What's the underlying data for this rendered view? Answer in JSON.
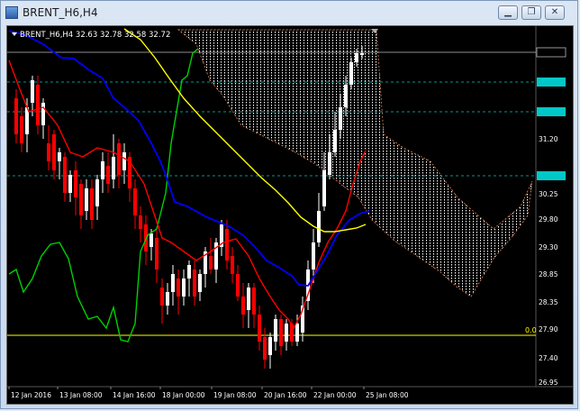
{
  "window": {
    "title": "BRENT_H6,H4",
    "minimize_icon": "minimize-icon",
    "restore_icon": "restore-icon",
    "close_icon": "close-icon"
  },
  "chart": {
    "header": "BRENT_H6,H4  32.63 32.78 32.58 32.72",
    "dropdown_icon": "triangle-down-icon",
    "price_labels": [
      "32.72",
      "32.16",
      "31.65",
      "31.20",
      "30.53",
      "30.25",
      "29.80",
      "29.30",
      "28.85",
      "28.35",
      "27.90",
      "27.40",
      "26.95"
    ],
    "time_labels": [
      "12 Jan 2016",
      "13 Jan 08:00",
      "14 Jan 16:00",
      "18 Jan 00:00",
      "19 Jan 08:00",
      "20 Jan 16:00",
      "22 Jan 00:00",
      "25 Jan 08:00"
    ],
    "level_label": "0.0",
    "colors": {
      "background": "#000000",
      "bull": "#ffffff",
      "bear": "#ff0000",
      "tenkan": "#ff0000",
      "kijun": "#0000ff",
      "chikou": "#00d000",
      "ma": "#ffff00",
      "cloud": "#ffffff",
      "cloud_edge": "#e08050",
      "level": "#ffff00",
      "grid_lines": "#00c8c8"
    }
  }
}
